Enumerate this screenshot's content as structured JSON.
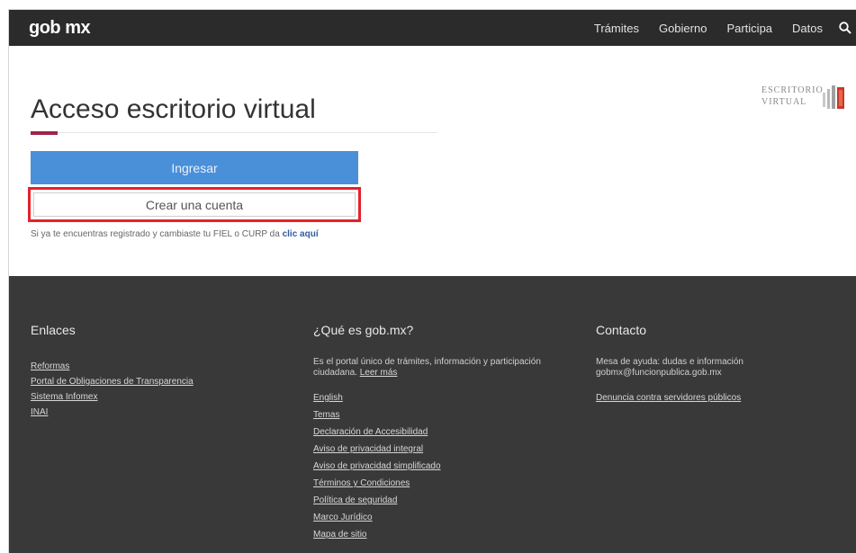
{
  "header": {
    "logo": "gob mx",
    "nav": [
      "Trámites",
      "Gobierno",
      "Participa",
      "Datos"
    ],
    "search_icon": "search-icon"
  },
  "main": {
    "title": "Acceso escritorio virtual",
    "brand_badge": {
      "line1": "ESCRITORIO",
      "line2": "VIRTUAL"
    },
    "primary_button": "Ingresar",
    "secondary_button": "Crear una cuenta",
    "help_text": "Si ya te encuentras registrado y cambiaste tu FIEL o CURP da ",
    "help_link": "clic aquí",
    "colors": {
      "accent": "#9d2449",
      "primary_button": "#4a90d9",
      "highlight_box": "#e3222b",
      "header_bg": "#2b2b2b",
      "footer_bg": "#393939"
    }
  },
  "footer": {
    "enlaces": {
      "title": "Enlaces",
      "links": [
        "Reformas",
        "Portal de Obligaciones de Transparencia",
        "Sistema Infomex",
        "INAI"
      ]
    },
    "que_es": {
      "title": "¿Qué es gob.mx?",
      "description": "Es el portal único de trámites, información y participación ciudadana.",
      "read_more": "Leer más",
      "links": [
        "English",
        "Temas",
        "Declaración de Accesibilidad",
        "Aviso de privacidad integral",
        "Aviso de privacidad simplificado",
        "Términos y Condiciones",
        "Política de seguridad",
        "Marco Jurídico",
        "Mapa de sitio"
      ]
    },
    "contacto": {
      "title": "Contacto",
      "line1": "Mesa de ayuda: dudas e información",
      "line2": "gobmx@funcionpublica.gob.mx",
      "links": [
        "Denuncia contra servidores públicos"
      ]
    }
  }
}
